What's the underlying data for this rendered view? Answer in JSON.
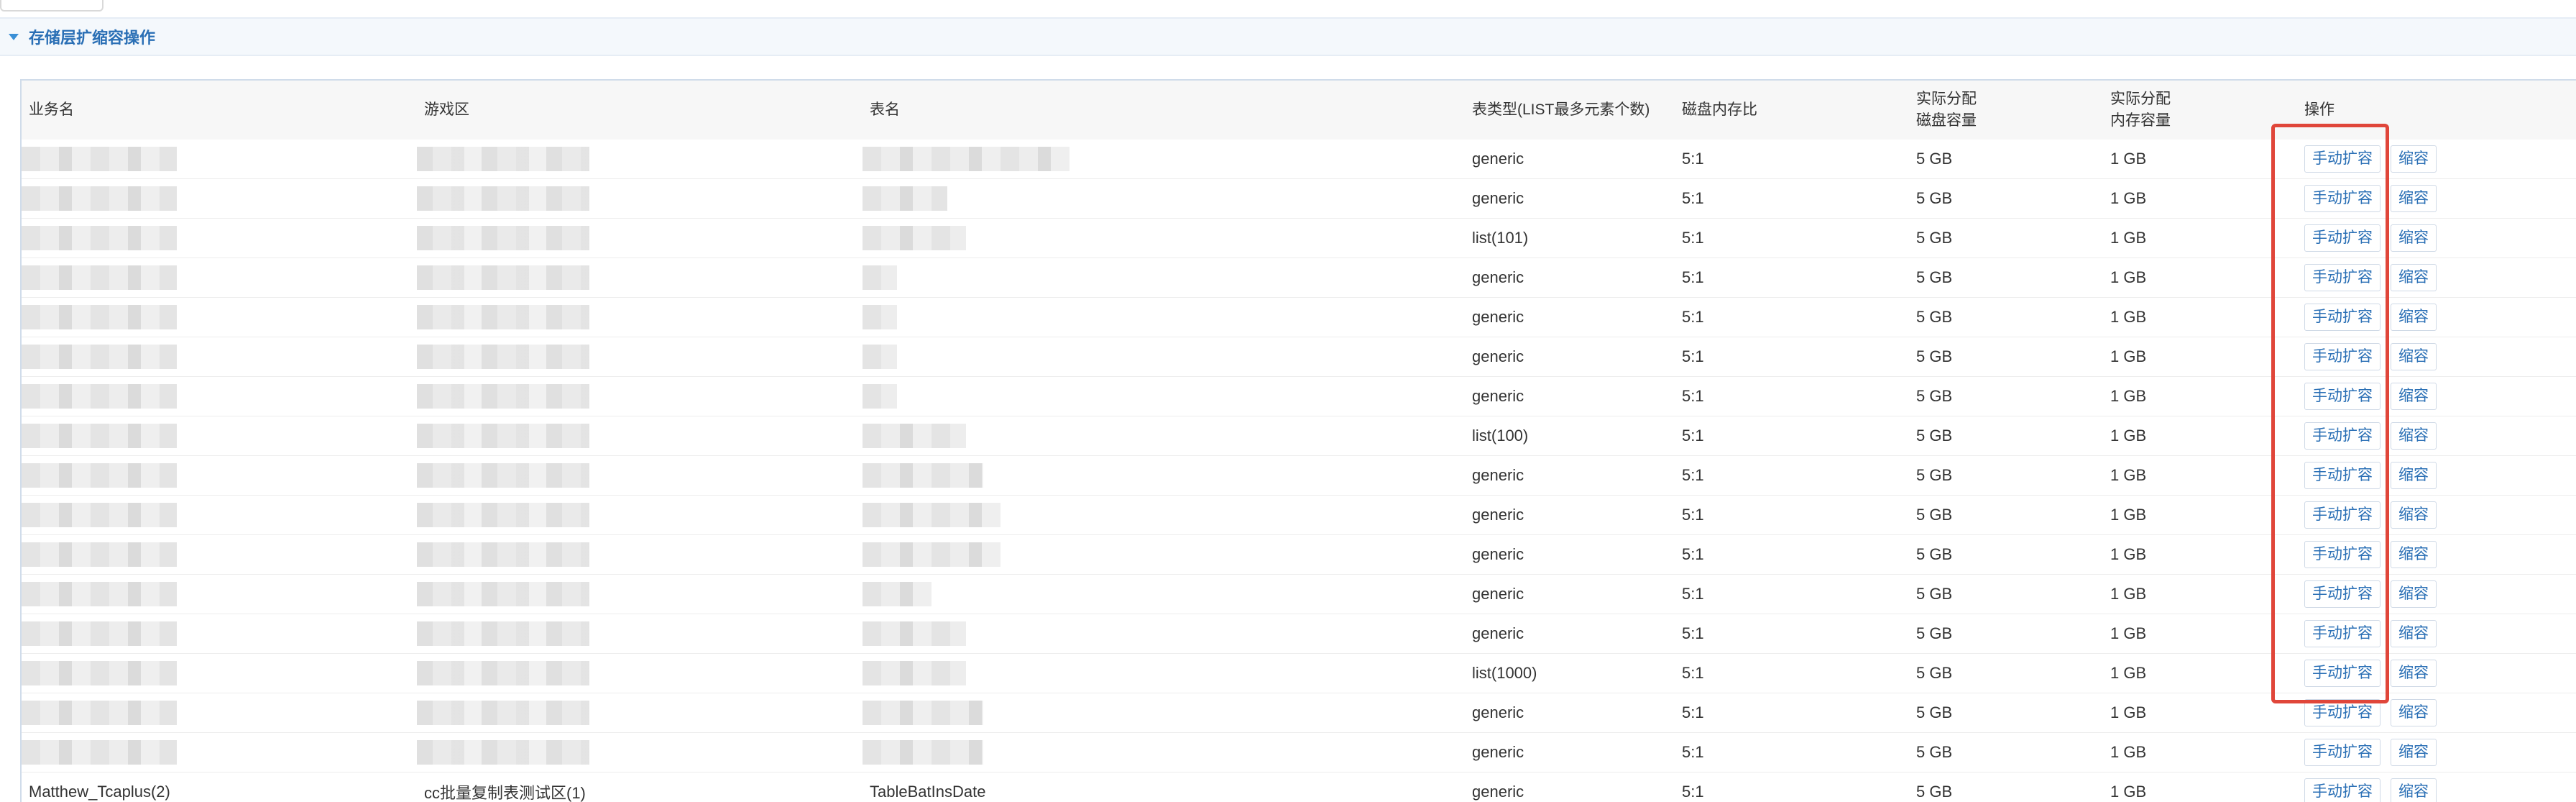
{
  "section": {
    "title": "存储层扩缩容操作"
  },
  "table": {
    "headers": {
      "business": "业务名",
      "zone": "游戏区",
      "table_name": "表名",
      "table_type": "表类型(LIST最多元素个数)",
      "disk_mem_ratio": "磁盘内存比",
      "disk_capacity_line1": "实际分配",
      "disk_capacity_line2": "磁盘容量",
      "mem_capacity_line1": "实际分配",
      "mem_capacity_line2": "内存容量",
      "ops": "操作"
    },
    "expand_label": "手动扩容",
    "shrink_label": "缩容",
    "rows": [
      {
        "type": "generic",
        "ratio": "5:1",
        "disk": "5 GB",
        "mem": "1 GB"
      },
      {
        "type": "generic",
        "ratio": "5:1",
        "disk": "5 GB",
        "mem": "1 GB"
      },
      {
        "type": "list(101)",
        "ratio": "5:1",
        "disk": "5 GB",
        "mem": "1 GB"
      },
      {
        "type": "generic",
        "ratio": "5:1",
        "disk": "5 GB",
        "mem": "1 GB"
      },
      {
        "type": "generic",
        "ratio": "5:1",
        "disk": "5 GB",
        "mem": "1 GB"
      },
      {
        "type": "generic",
        "ratio": "5:1",
        "disk": "5 GB",
        "mem": "1 GB"
      },
      {
        "type": "generic",
        "ratio": "5:1",
        "disk": "5 GB",
        "mem": "1 GB"
      },
      {
        "type": "list(100)",
        "ratio": "5:1",
        "disk": "5 GB",
        "mem": "1 GB"
      },
      {
        "type": "generic",
        "ratio": "5:1",
        "disk": "5 GB",
        "mem": "1 GB"
      },
      {
        "type": "generic",
        "ratio": "5:1",
        "disk": "5 GB",
        "mem": "1 GB"
      },
      {
        "type": "generic",
        "ratio": "5:1",
        "disk": "5 GB",
        "mem": "1 GB"
      },
      {
        "type": "generic",
        "ratio": "5:1",
        "disk": "5 GB",
        "mem": "1 GB"
      },
      {
        "type": "generic",
        "ratio": "5:1",
        "disk": "5 GB",
        "mem": "1 GB"
      },
      {
        "type": "list(1000)",
        "ratio": "5:1",
        "disk": "5 GB",
        "mem": "1 GB"
      },
      {
        "type": "generic",
        "ratio": "5:1",
        "disk": "5 GB",
        "mem": "1 GB"
      },
      {
        "type": "generic",
        "ratio": "5:1",
        "disk": "5 GB",
        "mem": "1 GB"
      },
      {
        "business": "Matthew_Tcaplus(2)",
        "zone": "cc批量复制表测试区(1)",
        "table_name": "TableBatInsDate",
        "type": "generic",
        "ratio": "5:1",
        "disk": "5 GB",
        "mem": "1 GB"
      }
    ]
  }
}
